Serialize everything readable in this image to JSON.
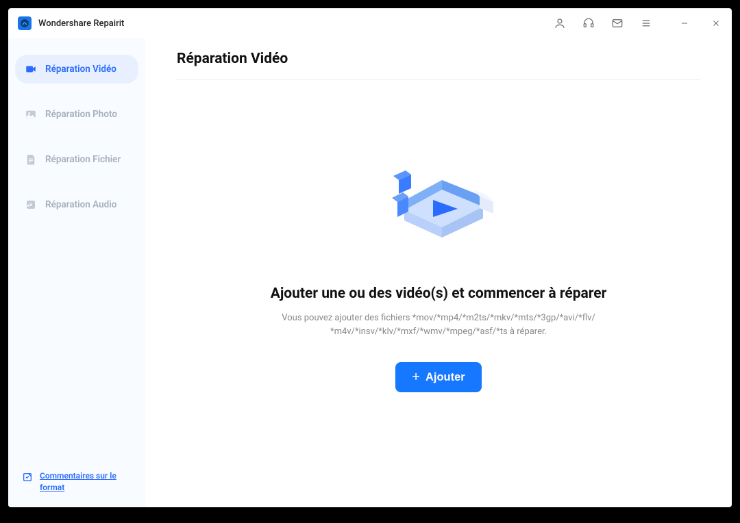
{
  "app": {
    "title": "Wondershare Repairit"
  },
  "sidebar": {
    "items": [
      {
        "label": "Réparation Vidéo",
        "active": true
      },
      {
        "label": "Réparation Photo",
        "active": false
      },
      {
        "label": "Réparation Fichier",
        "active": false
      },
      {
        "label": "Réparation Audio",
        "active": false
      }
    ],
    "footer_link": "Commentaires sur le format"
  },
  "main": {
    "page_title": "Réparation Vidéo",
    "heading": "Ajouter une ou des vidéo(s) et commencer à réparer",
    "subtext": "Vous pouvez ajouter des fichiers *mov/*mp4/*m2ts/*mkv/*mts/*3gp/*avi/*flv/ *m4v/*insv/*klv/*mxf/*wmv/*mpeg/*asf/*ts à réparer.",
    "add_button": "Ajouter"
  },
  "colors": {
    "accent": "#1677ff",
    "sidebar_bg": "#f8fbff",
    "active_bg": "#e8f0ff"
  }
}
